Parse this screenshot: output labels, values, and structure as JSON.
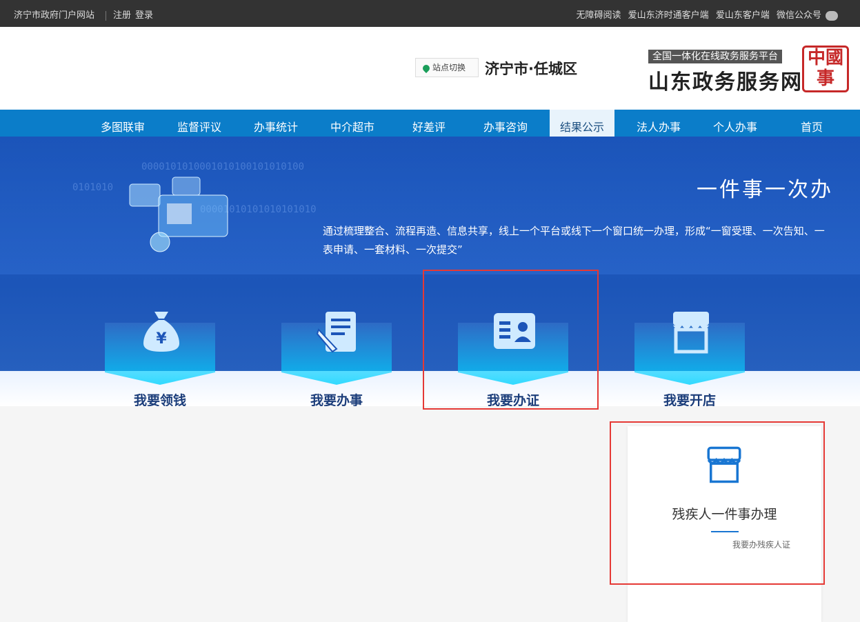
{
  "topbar": {
    "site_name": "济宁市政府门户网站",
    "login": "登录",
    "register": "注册",
    "wechat": "微信公众号",
    "shandong_client": "爱山东客户端",
    "jining_client": "爱山东济时通客户端",
    "accessibility": "无障碍阅读"
  },
  "header": {
    "seal_text": "中國事",
    "subtitle": "全国一体化在线政务服务平台",
    "title": "山东政务服务网",
    "city": "济宁市·任城区",
    "switch_label": "站点切换"
  },
  "nav": {
    "items": [
      "首页",
      "个人办事",
      "法人办事",
      "结果公示",
      "办事咨询",
      "好差评",
      "中介超市",
      "办事统计",
      "监督评议",
      "多图联审"
    ],
    "active": "结果公示"
  },
  "banner": {
    "title": "一件事一次办",
    "description": "通过梳理整合、流程再造、信息共享，线上一个平台或线下一个窗口统一办理，形成“一窗受理、一次告知、一表申请、一套材料、一次提交”",
    "binary_lines": [
      "0000101010001010100101010100",
      "0101010",
      "00001010101010101010",
      "0101010"
    ]
  },
  "cards": [
    {
      "label": "我要开店",
      "icon": "shop-icon"
    },
    {
      "label": "我要办证",
      "icon": "id-card-icon"
    },
    {
      "label": "我要办事",
      "icon": "document-edit-icon"
    },
    {
      "label": "我要领钱",
      "icon": "money-bag-icon"
    }
  ],
  "panel": {
    "title": "残疾人一件事办理",
    "subtitle": "我要办残疾人证",
    "icon": "shop-icon"
  },
  "colors": {
    "nav_bg": "#0b7dc9",
    "banner_bg": "#1f5fc7",
    "highlight": "#e53935",
    "accent": "#1976d2"
  }
}
